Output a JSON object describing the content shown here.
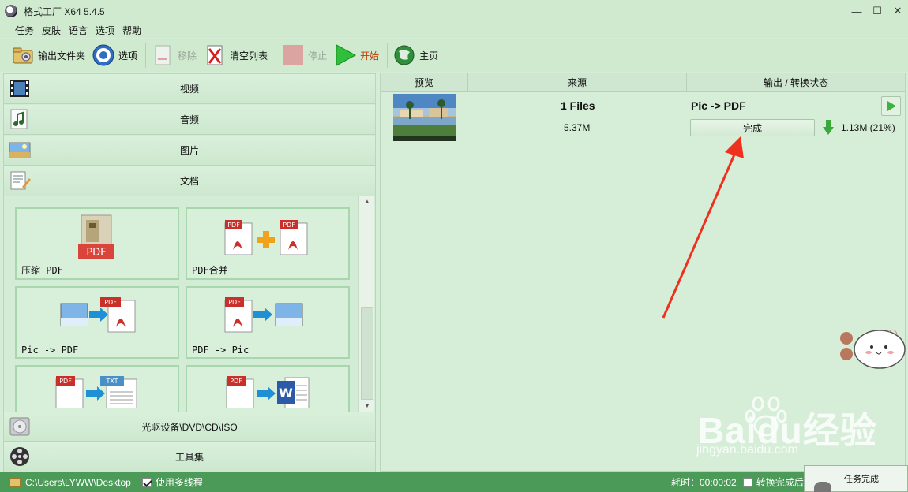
{
  "window": {
    "title": "格式工厂 X64 5.4.5",
    "controls": [
      "—",
      "☐",
      "✕"
    ]
  },
  "menu": [
    "任务",
    "皮肤",
    "语言",
    "选项",
    "帮助"
  ],
  "toolbar": {
    "output_folder": "输出文件夹",
    "options": "选项",
    "remove": "移除",
    "clear_list": "清空列表",
    "stop": "停止",
    "start": "开始",
    "home": "主页"
  },
  "categories": {
    "video": "视频",
    "audio": "音频",
    "image": "图片",
    "document": "文档",
    "optical": "光驱设备\\DVD\\CD\\ISO",
    "tools": "工具集"
  },
  "tools": [
    {
      "label": "压缩 PDF"
    },
    {
      "label": "PDF合并"
    },
    {
      "label": "Pic -> PDF"
    },
    {
      "label": "PDF -> Pic"
    },
    {
      "label": ""
    },
    {
      "label": ""
    }
  ],
  "tool_icon_text": {
    "pdf": "PDF",
    "txt": "TXT",
    "word": "W"
  },
  "columns": {
    "preview": "预览",
    "source": "来源",
    "status": "输出 / 转换状态"
  },
  "task": {
    "files": "1 Files",
    "size": "5.37M",
    "conversion": "Pic -> PDF",
    "state": "完成",
    "result": "1.13M  (21%)"
  },
  "status": {
    "path": "C:\\Users\\LYWW\\Desktop",
    "multithread_label": "使用多线程",
    "multithread_checked": true,
    "elapsed": "耗时：00:00:02",
    "after_label": "转换完成后：关",
    "toast": "任务完成"
  },
  "colors": {
    "accent": "#4b9a58",
    "annotation_arrow": "#f0301e",
    "start_text": "#c23b00"
  }
}
